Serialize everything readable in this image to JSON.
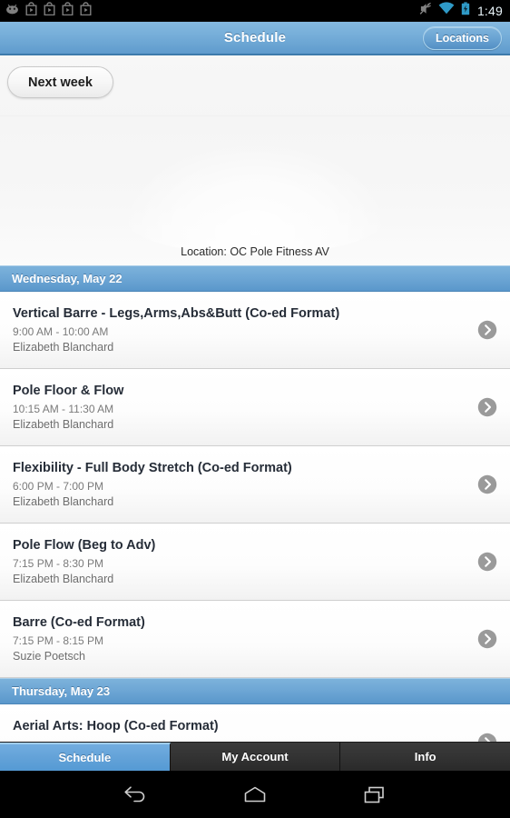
{
  "status_bar": {
    "left_icons": [
      "android-robot-icon",
      "play-store-icon",
      "play-store-icon",
      "play-store-icon",
      "play-store-icon"
    ],
    "right_icons": [
      "mute-icon",
      "wifi-icon",
      "battery-charging-icon"
    ],
    "time": "1:49"
  },
  "title_bar": {
    "title": "Schedule",
    "locations_label": "Locations",
    "accent_color": "#6aa4d3"
  },
  "header": {
    "next_week_label": "Next week",
    "location_label": "Location: OC Pole Fitness AV"
  },
  "schedule": {
    "days": [
      {
        "date_label": "Wednesday, May 22",
        "classes": [
          {
            "title": "Vertical Barre - Legs,Arms,Abs&Butt (Co-ed Format)",
            "time": "9:00 AM - 10:00 AM",
            "instructor": "Elizabeth Blanchard"
          },
          {
            "title": "Pole Floor & Flow",
            "time": "10:15 AM - 11:30 AM",
            "instructor": "Elizabeth Blanchard"
          },
          {
            "title": "Flexibility - Full Body Stretch (Co-ed Format)",
            "time": "6:00 PM - 7:00 PM",
            "instructor": "Elizabeth Blanchard"
          },
          {
            "title": "Pole Flow (Beg to Adv)",
            "time": "7:15 PM - 8:30 PM",
            "instructor": "Elizabeth Blanchard"
          },
          {
            "title": "Barre (Co-ed Format)",
            "time": "7:15 PM - 8:15 PM",
            "instructor": "Suzie Poetsch"
          }
        ]
      },
      {
        "date_label": "Thursday, May 23",
        "classes": [
          {
            "title": "Aerial Arts: Hoop (Co-ed Format)",
            "time": "",
            "instructor": ""
          }
        ]
      }
    ]
  },
  "tabs": [
    {
      "label": "Schedule",
      "active": true
    },
    {
      "label": "My Account",
      "active": false
    },
    {
      "label": "Info",
      "active": false
    }
  ],
  "nav_bar": {
    "buttons": [
      "back-icon",
      "home-icon",
      "recents-icon"
    ]
  }
}
